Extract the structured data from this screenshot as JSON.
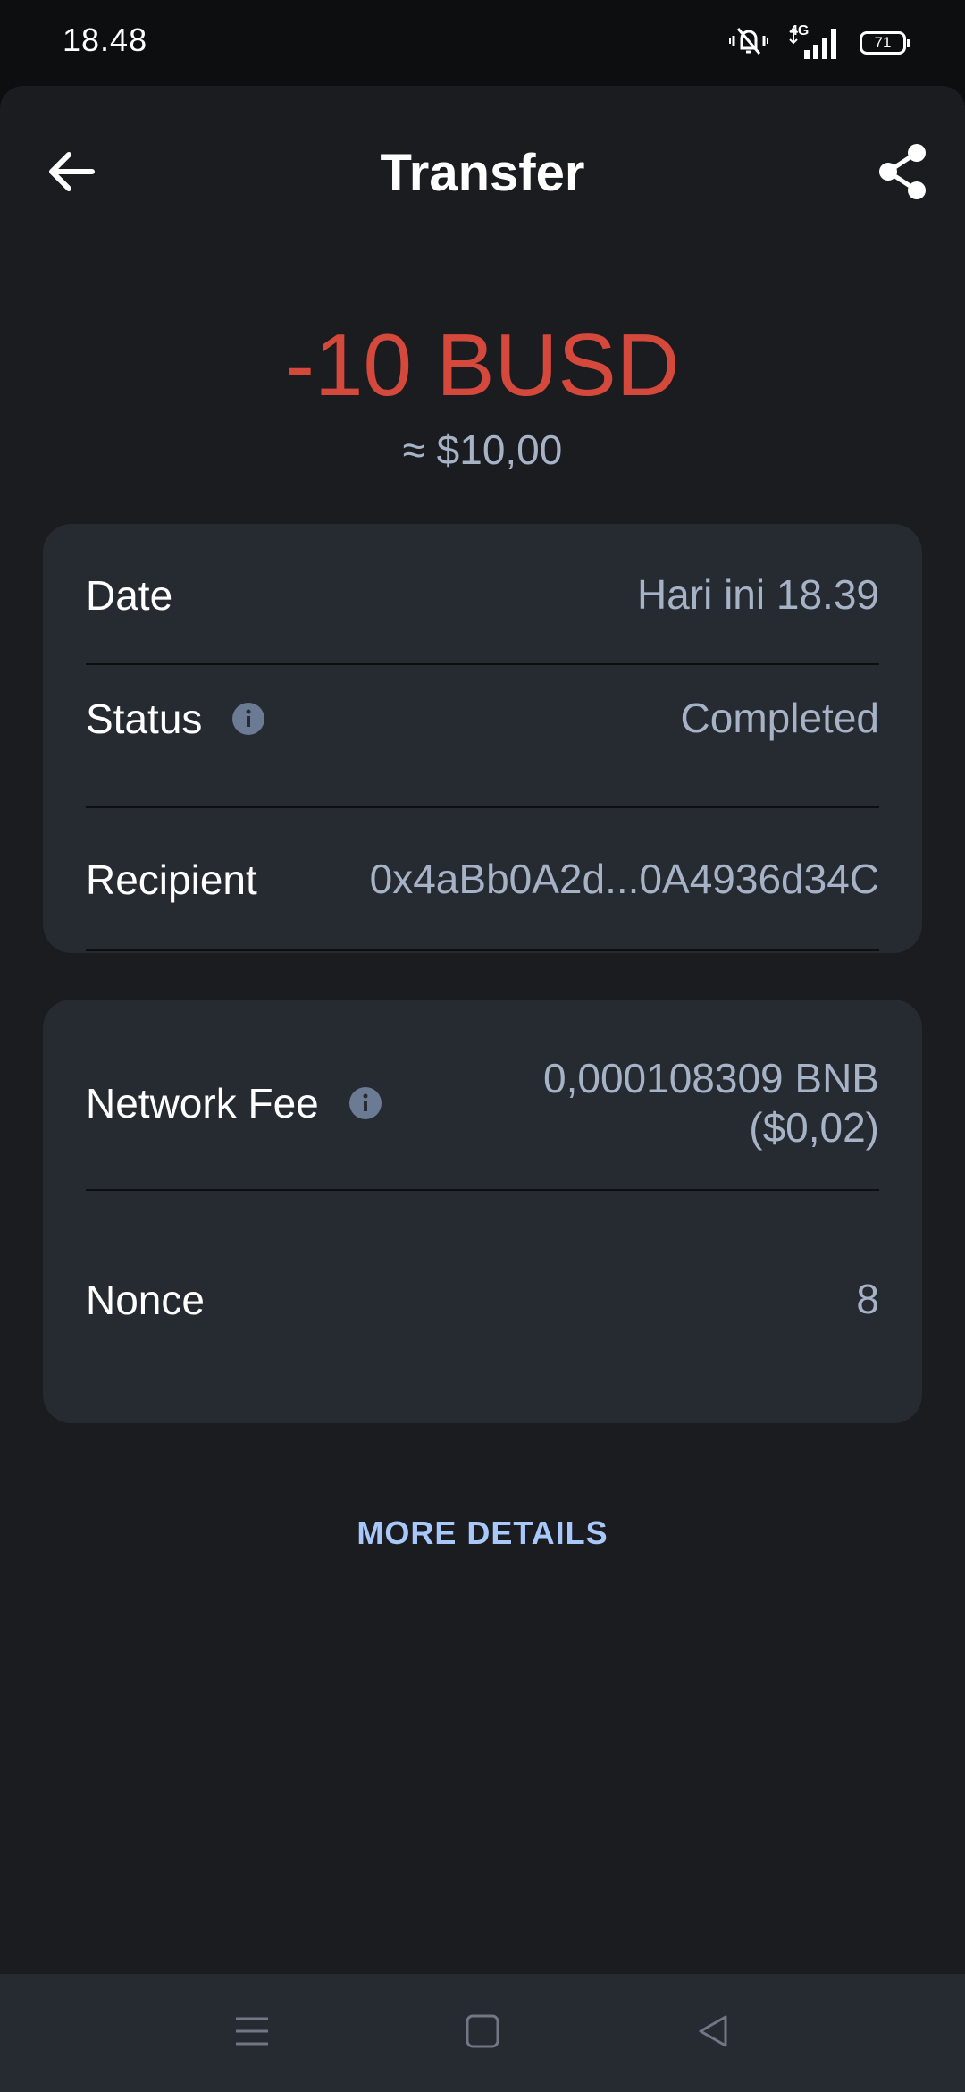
{
  "status_bar": {
    "time": "18.48",
    "network": "4G",
    "battery": "71",
    "icons": [
      "vibrate-mute-icon",
      "signal-4g-icon",
      "battery-icon"
    ]
  },
  "header": {
    "title": "Transfer",
    "back_icon": "arrow-left-icon",
    "share_icon": "share-icon"
  },
  "summary": {
    "amount": "-10 BUSD",
    "fiat": "≈ $10,00",
    "amount_color": "#d4493b"
  },
  "details": {
    "date_label": "Date",
    "date_value": "Hari ini 18.39",
    "status_label": "Status",
    "status_value": "Completed",
    "recipient_label": "Recipient",
    "recipient_value": "0x4aBb0A2d...0A4936d34C"
  },
  "fees": {
    "network_fee_label": "Network Fee",
    "network_fee_value": "0,000108309 BNB",
    "network_fee_fiat": "($0,02)",
    "nonce_label": "Nonce",
    "nonce_value": "8"
  },
  "actions": {
    "more_details": "MORE DETAILS",
    "link_color": "#a8c7fa"
  },
  "nav_bar": {
    "icons": [
      "menu-icon",
      "home-square-icon",
      "back-triangle-icon"
    ]
  }
}
